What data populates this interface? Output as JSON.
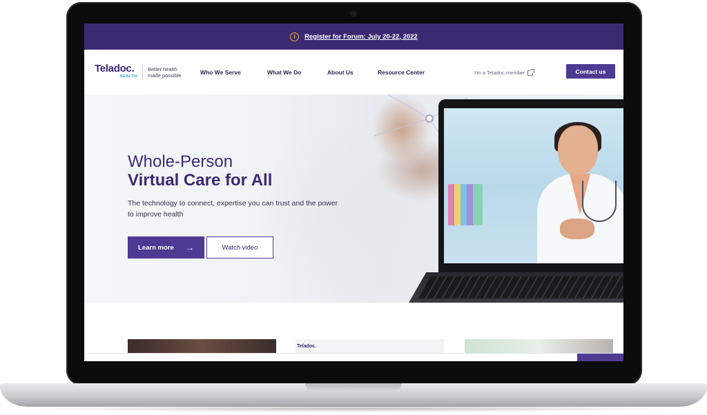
{
  "banner": {
    "link_text": "Register for Forum: July 20-22, 2022",
    "icon": "info-icon",
    "background": "#3b2a72",
    "icon_color": "#f0a93a"
  },
  "nav": {
    "logo_text": "Teladoc.",
    "logo_sub": "HEALTH",
    "tagline_line1": "Better health",
    "tagline_line2": "made possible",
    "items": [
      {
        "label": "Who We Serve"
      },
      {
        "label": "What We Do"
      },
      {
        "label": "About Us"
      },
      {
        "label": "Resource Center"
      }
    ],
    "member_link": "I'm a Teladoc member",
    "contact_label": "Contact us"
  },
  "hero": {
    "title_light": "Whole-Person",
    "title_bold": "Virtual Care for All",
    "subtitle": "The technology to connect, expertise you can trust and the power to improve health",
    "learn_more_label": "Learn more",
    "watch_video_label": "Watch video"
  },
  "cards": {
    "logo_text": "Teladoc."
  },
  "colors": {
    "brand_purple": "#4e3a92",
    "heading": "#3b2a72",
    "accent_blue": "#2f9bd8"
  }
}
